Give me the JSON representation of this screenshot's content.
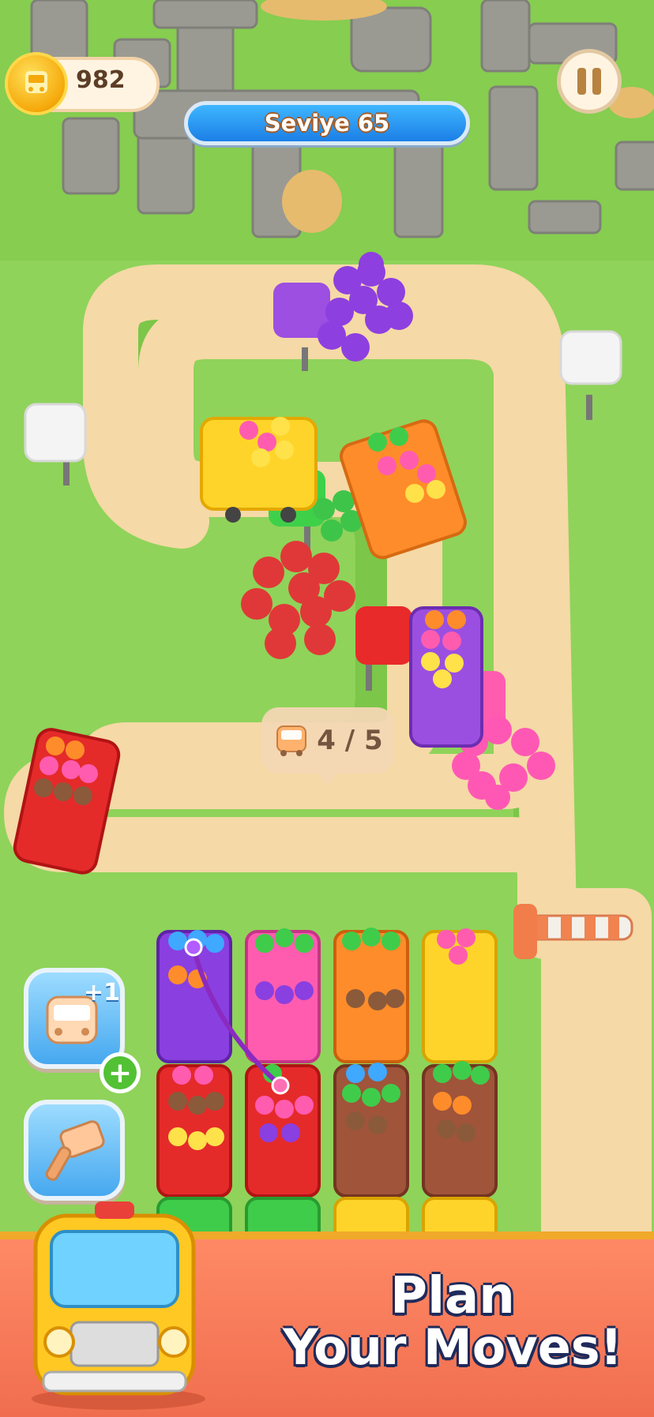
{
  "hud": {
    "coins": "982",
    "level": "Seviye 65",
    "pause_icon": "pause-icon",
    "coin_icon": "bus-coin-icon"
  },
  "board": {
    "counter_text": "4 / 5",
    "counter_icon": "bus-icon"
  },
  "boosters": [
    {
      "icon": "bus-plus-one-icon",
      "label": "+1"
    },
    {
      "icon": "hammer-icon"
    }
  ],
  "banner": {
    "line1": "Plan",
    "line2": "Your Moves!"
  },
  "colors": {
    "grass": "#8fd35a",
    "path": "#f5d9a6",
    "level_bar": "#1b7fe6",
    "banner": "#f06e4f"
  }
}
